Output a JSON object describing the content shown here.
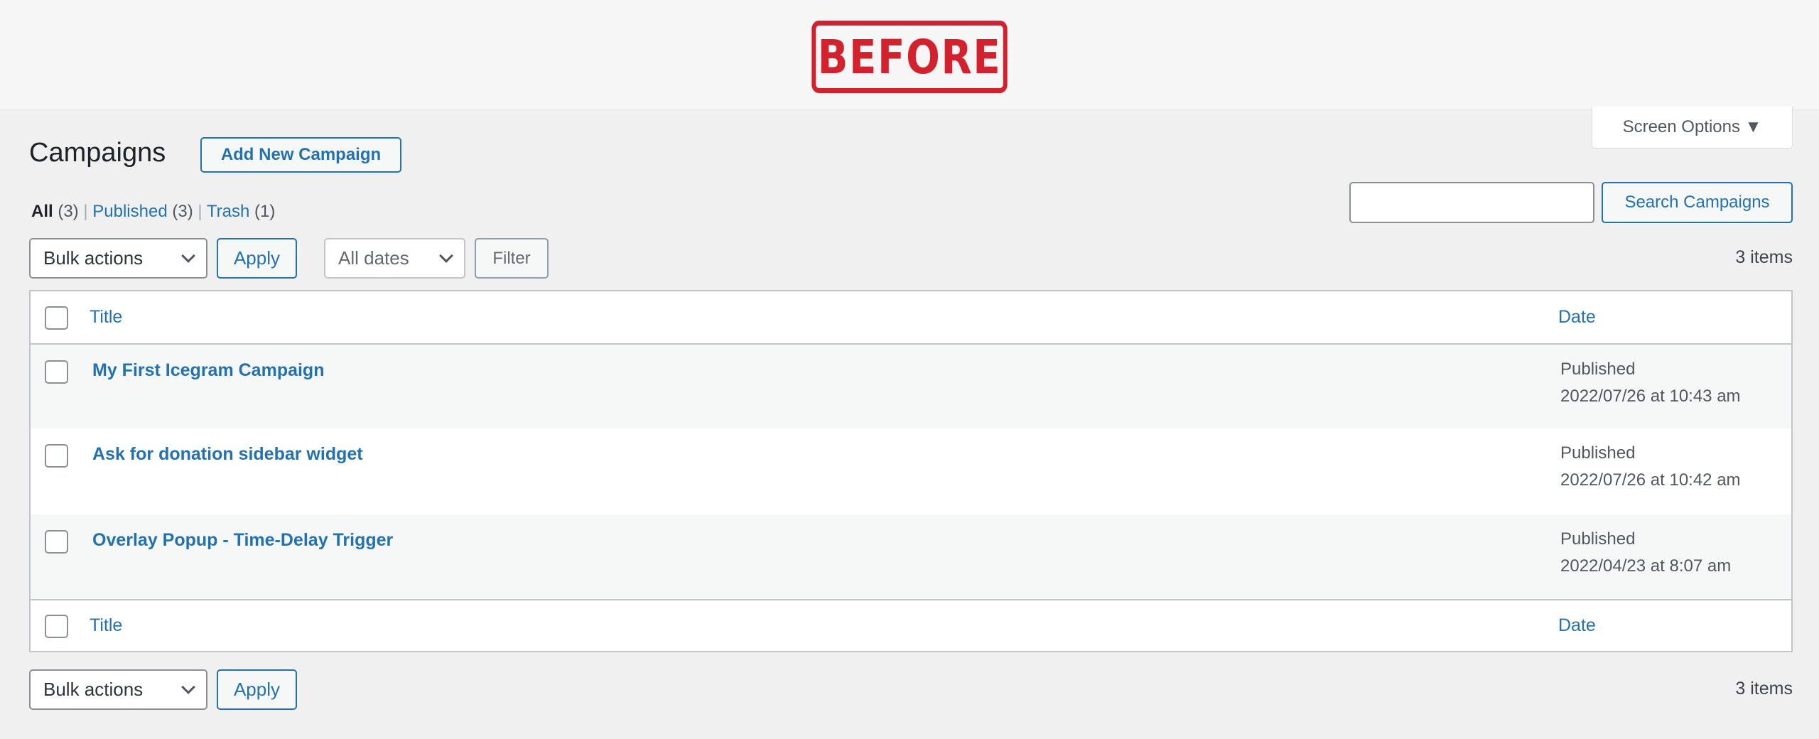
{
  "stamp": "BEFORE",
  "header": {
    "title": "Campaigns",
    "add_new": "Add New Campaign",
    "screen_options": "Screen Options ▼"
  },
  "views": [
    {
      "label": "All",
      "count": "(3)"
    },
    {
      "label": "Published",
      "count": "(3)"
    },
    {
      "label": "Trash",
      "count": "(1)"
    }
  ],
  "search": {
    "value": "",
    "button": "Search Campaigns"
  },
  "toolbar": {
    "bulk": "Bulk actions",
    "apply": "Apply",
    "dates": "All dates",
    "filter": "Filter",
    "count": "3 items"
  },
  "table": {
    "col_title": "Title",
    "col_date": "Date",
    "rows": [
      {
        "title": "My First Icegram Campaign",
        "status": "Published",
        "date": "2022/07/26 at 10:43 am"
      },
      {
        "title": "Ask for donation sidebar widget",
        "status": "Published",
        "date": "2022/07/26 at 10:42 am"
      },
      {
        "title": "Overlay Popup - Time-Delay Trigger",
        "status": "Published",
        "date": "2022/04/23 at 8:07 am"
      }
    ]
  },
  "colors": {
    "link": "#2271b1",
    "stamp": "#d3212d"
  }
}
